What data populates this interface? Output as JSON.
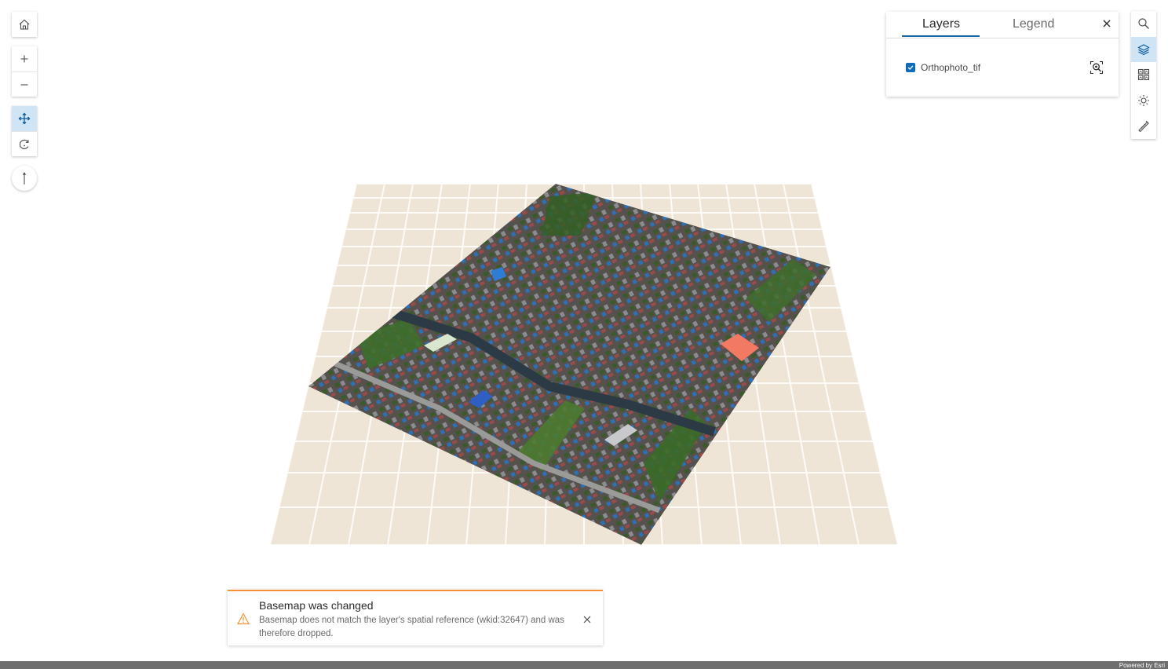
{
  "panel": {
    "tabs": [
      {
        "label": "Layers",
        "active": true
      },
      {
        "label": "Legend",
        "active": false
      }
    ],
    "layers": [
      {
        "label": "Orthophoto_tif",
        "visible": true
      }
    ]
  },
  "left_controls": {
    "icons": [
      "home-icon",
      "zoom-in-icon",
      "zoom-out-icon",
      "pan-icon",
      "rotate-icon",
      "compass-icon"
    ],
    "active": "pan-icon"
  },
  "right_toolbar": {
    "icons": [
      "search-icon",
      "layers-icon",
      "basemap-gallery-icon",
      "daylight-icon",
      "measure-icon"
    ],
    "active": "layers-icon"
  },
  "notice": {
    "title": "Basemap was changed",
    "message": "Basemap does not match the layer's spatial reference (wkid:32647) and was therefore dropped.",
    "accent_color": "#f5922f"
  },
  "attribution": "Powered by Esri",
  "colors": {
    "accent": "#1a67a6",
    "ground_grid": "#efe5d6"
  }
}
